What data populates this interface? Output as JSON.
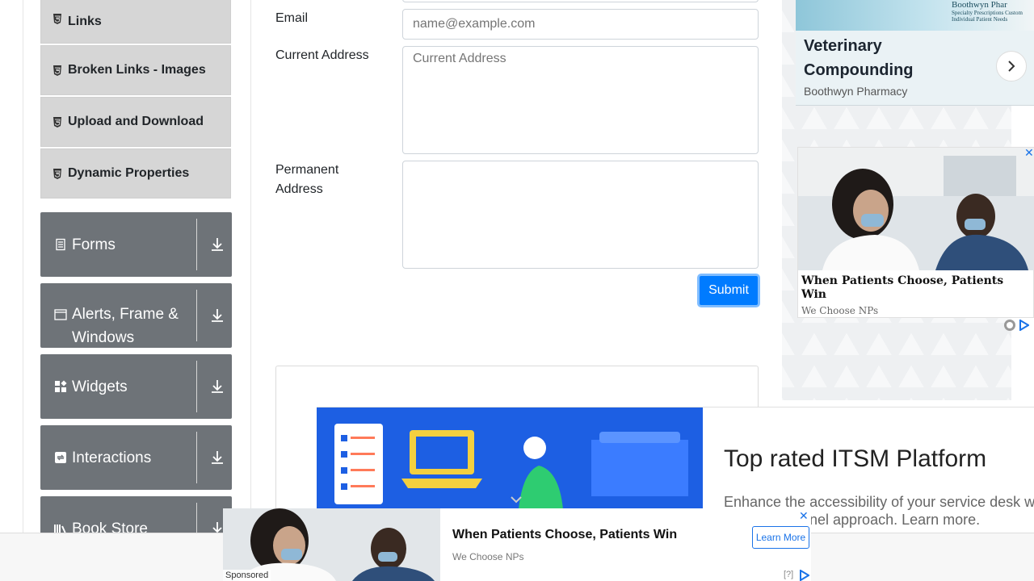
{
  "sidebar": {
    "elements_items": [
      {
        "label": "Links"
      },
      {
        "label": "Broken Links - Images"
      },
      {
        "label": "Upload and Download"
      },
      {
        "label": "Dynamic Properties"
      }
    ],
    "groups": [
      {
        "label": "Forms",
        "icon": "form-icon"
      },
      {
        "label": "Alerts, Frame & Windows",
        "icon": "window-icon"
      },
      {
        "label": "Widgets",
        "icon": "widgets-icon"
      },
      {
        "label": "Interactions",
        "icon": "interactions-icon"
      },
      {
        "label": "Book Store",
        "icon": "book-icon"
      }
    ]
  },
  "form": {
    "email_label": "Email",
    "email_placeholder": "name@example.com",
    "current_address_label": "Current Address",
    "current_address_placeholder": "Current Address",
    "permanent_address_label": "Permanent Address",
    "submit_label": "Submit"
  },
  "ads": {
    "top_right": {
      "title": "Veterinary Compounding",
      "advertiser": "Boothwyn Pharmacy",
      "brand": "Boothwyn Phar",
      "brand_tagline": "Specialty Prescriptions Custom Individual Patient Needs"
    },
    "mid_right": {
      "title": "When Patients Choose, Patients Win",
      "advertiser": "We Choose NPs"
    },
    "itsm": {
      "title": "Top rated ITSM Platform",
      "body": "Enhance the accessibility of your service desk w\nnnel approach. Learn more."
    },
    "bottom": {
      "sponsored": "Sponsored",
      "title": "When Patients Choose, Patients Win",
      "advertiser": "We Choose NPs",
      "cta": "Learn More",
      "help": "[?]"
    }
  },
  "colors": {
    "primary": "#007bff",
    "group_bg": "#6e7378",
    "item_bg": "#d6d6d6"
  }
}
